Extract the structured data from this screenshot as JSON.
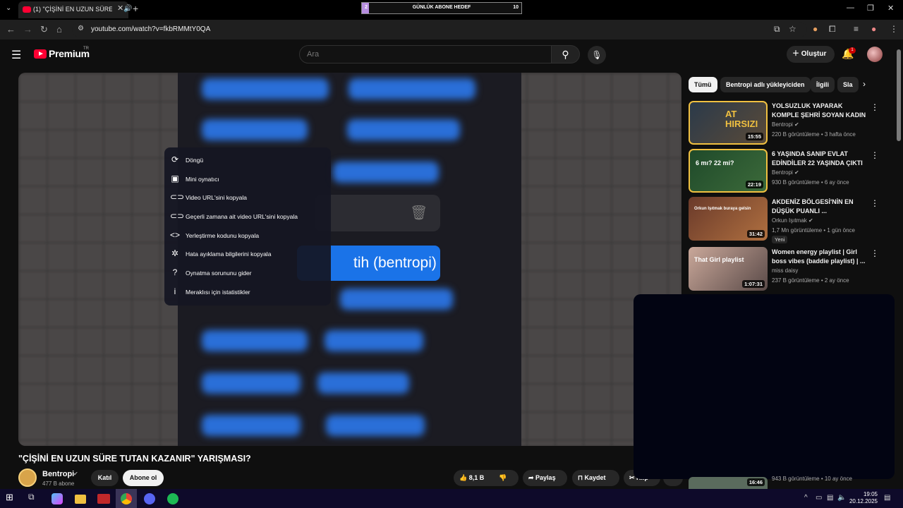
{
  "browser": {
    "tab_title": "(1) \"ÇİŞİNİ EN UZUN SÜRE",
    "url": "youtube.com/watch?v=fkbRMMtY0QA",
    "goal_widget": {
      "current": "2",
      "label": "GÜNLÜK ABONE HEDEF",
      "target": "10",
      "progress": 0.2
    }
  },
  "header": {
    "logo": "Premium",
    "region": "TR",
    "search_placeholder": "Ara",
    "create_label": "Oluştur",
    "notification_count": "1"
  },
  "video_overlay": {
    "button_text": "tih (bentropi)"
  },
  "context_menu": [
    {
      "label": "Döngü",
      "icon": "loop-icon",
      "glyph": "⟳"
    },
    {
      "label": "Mini oynatıcı",
      "icon": "miniplayer-icon",
      "glyph": "▣"
    },
    {
      "label": "Video URL'sini kopyala",
      "icon": "link-icon",
      "glyph": "⊂⊃"
    },
    {
      "label": "Geçerli zamana ait video URL'sini kopyala",
      "icon": "link-icon",
      "glyph": "⊂⊃"
    },
    {
      "label": "Yerleştirme kodunu kopyala",
      "icon": "embed-icon",
      "glyph": "<>"
    },
    {
      "label": "Hata ayıklama bilgilerini kopyala",
      "icon": "debug-icon",
      "glyph": "✲"
    },
    {
      "label": "Oynatma sorununu gider",
      "icon": "help-icon",
      "glyph": "?"
    },
    {
      "label": "Meraklısı için istatistikler",
      "icon": "info-icon",
      "glyph": "i"
    }
  ],
  "video": {
    "title": "\"ÇİŞİNİ EN UZUN SÜRE TUTAN KAZANIR\" YARIŞMASI?",
    "channel": "Bentropi",
    "subscribers": "477 B abone",
    "join_label": "Katıl",
    "subscribe_label": "Abone ol",
    "likes": "8,1 B",
    "share_label": "Paylaş",
    "save_label": "Kaydet",
    "clip_label": "Klip"
  },
  "chips": [
    "Tümü",
    "Bentropi adlı yükleyiciden",
    "İlgili",
    "Sla"
  ],
  "recommendations": [
    {
      "title": "YOLSUZLUK YAPARAK KOMPLE ŞEHRİ SOYAN KADIN",
      "channel": "Bentropi",
      "verified": true,
      "meta": "220 B görüntüleme • 3 hafta önce",
      "duration": "15:55",
      "thumb_text": "AT HIRSIZI",
      "new": false
    },
    {
      "title": "6 YAŞINDA SANIP EVLAT EDİNDİLER 22 YAŞINDA ÇIKTI",
      "channel": "Bentropi",
      "verified": true,
      "meta": "930 B görüntüleme • 6 ay önce",
      "duration": "22:19",
      "thumb_text": "6 mı? 22 mi?",
      "new": false
    },
    {
      "title": "AKDENİZ BÖLGESİ'NİN EN DÜŞÜK PUANLI ...",
      "channel": "Orkun Işıtmak",
      "verified": true,
      "meta": "1,7 Mn görüntüleme • 1 gün önce",
      "duration": "31:42",
      "thumb_text": "Orkun Işıtmak buraya gelsin",
      "new": true,
      "new_label": "Yeni"
    },
    {
      "title": "Women energy playlist | Girl boss vibes (baddie playlist) | ...",
      "channel": "miss daisy",
      "verified": false,
      "meta": "237 B görüntüleme • 2 ay önce",
      "duration": "1:07:31",
      "thumb_text": "That Girl playlist",
      "new": false
    }
  ],
  "partial_recommendation": {
    "meta": "943 B görüntüleme • 10 ay önce",
    "duration": "16:46"
  },
  "taskbar": {
    "time": "19:05",
    "date": "20.12.2025"
  },
  "colors": {
    "yt_red": "#ff0033",
    "accent_blue": "#1a73e8",
    "bg": "#0f0f0f"
  }
}
